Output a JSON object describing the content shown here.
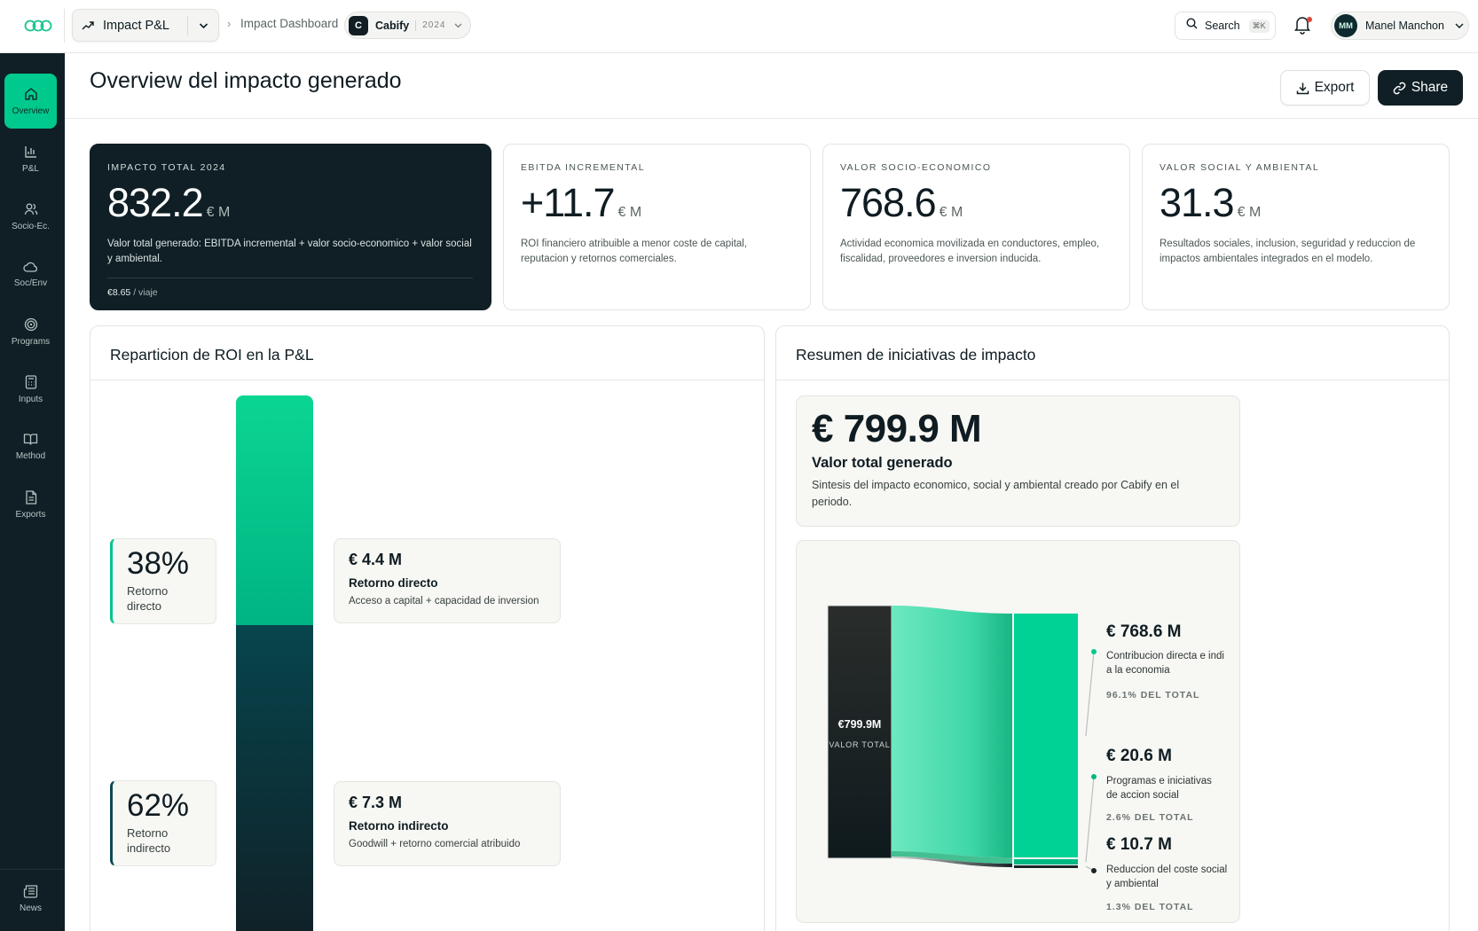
{
  "topbar": {
    "product": "Impact P&L",
    "breadcrumb": "Impact Dashboard",
    "company": {
      "initial": "C",
      "name": "Cabify",
      "year": "2024"
    },
    "search": {
      "label": "Search",
      "shortcut": "⌘K"
    },
    "user": {
      "initials": "MM",
      "name": "Manel Manchon"
    }
  },
  "sidebar": {
    "items": [
      {
        "label": "Overview",
        "icon": "home-icon",
        "active": true
      },
      {
        "label": "P&L",
        "icon": "bar-chart-icon"
      },
      {
        "label": "Socio-Ec.",
        "icon": "users-icon"
      },
      {
        "label": "Soc/Env",
        "icon": "cloud-icon"
      },
      {
        "label": "Programs",
        "icon": "target-icon"
      },
      {
        "label": "Inputs",
        "icon": "calculator-icon"
      },
      {
        "label": "Method",
        "icon": "book-icon"
      },
      {
        "label": "Exports",
        "icon": "file-icon"
      }
    ],
    "bottom": {
      "label": "News",
      "icon": "newspaper-icon"
    }
  },
  "header": {
    "title": "Overview del impacto generado",
    "export_label": "Export",
    "share_label": "Share"
  },
  "kpis": [
    {
      "label": "IMPACTO TOTAL 2024",
      "value": "832.2",
      "unit": "€ M",
      "desc": "Valor total generado: EBITDA incremental + valor socio-economico + valor social y ambiental.",
      "foot_value": "€8.65",
      "foot_unit": "/ viaje"
    },
    {
      "label": "EBITDA INCREMENTAL",
      "value": "+11.7",
      "unit": "€ M",
      "desc": "ROI financiero atribuible a menor coste de capital, reputacion y retornos comerciales."
    },
    {
      "label": "VALOR SOCIO-ECONOMICO",
      "value": "768.6",
      "unit": "€ M",
      "desc": "Actividad economica movilizada en conductores, empleo, fiscalidad, proveedores e inversion inducida."
    },
    {
      "label": "VALOR SOCIAL Y AMBIENTAL",
      "value": "31.3",
      "unit": "€ M",
      "desc": "Resultados sociales, inclusion, seguridad y reduccion de impactos ambientales integrados en el modelo."
    }
  ],
  "roi_panel": {
    "title": "Reparticion de ROI en la P&L",
    "direct": {
      "pct": "38%",
      "label": "Retorno directo",
      "share": 0.38,
      "value": "€ 4.4 M",
      "name": "Retorno directo",
      "desc": "Acceso a capital + capacidad de inversion"
    },
    "indirect": {
      "pct": "62%",
      "label": "Retorno indirecto",
      "share": 0.62,
      "value": "€ 7.3 M",
      "name": "Retorno indirecto",
      "desc": "Goodwill + retorno comercial atribuido"
    }
  },
  "summary_panel": {
    "title": "Resumen de iniciativas de impacto",
    "total_value": "€ 799.9 M",
    "total_title": "Valor total generado",
    "total_desc": "Sintesis del impacto economico, social y ambiental creado por Cabify en el periodo.",
    "sankey": {
      "source_value": "€799.9M",
      "source_label": "VALOR TOTAL",
      "flows": [
        {
          "value": "€ 768.6 M",
          "label": "Contribucion directa e indirecta a la economia",
          "share": "96.1% DEL TOTAL",
          "color": "#00d195"
        },
        {
          "value": "€ 20.6 M",
          "label": "Programas e iniciativas de accion social",
          "share": "2.6% DEL TOTAL",
          "color": "#00b883"
        },
        {
          "value": "€ 10.7 M",
          "label": "Reduccion del coste social y ambiental",
          "share": "1.3% DEL TOTAL",
          "color": "#1a2428"
        }
      ]
    }
  },
  "colors": {
    "accent": "#00c98e",
    "dark": "#0f1f25"
  }
}
